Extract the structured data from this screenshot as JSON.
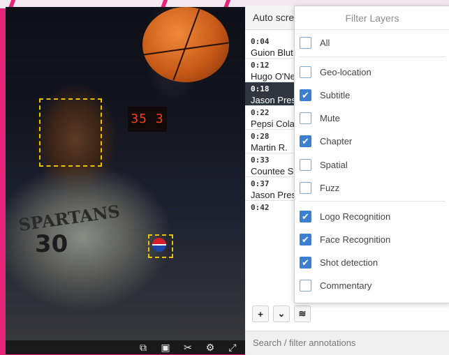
{
  "video": {
    "scoreboard_text": "35 3",
    "jersey_text": "SPARTANS",
    "jersey_number": "30",
    "toolbar": [
      "crop-icon",
      "frame-icon",
      "scissors-icon",
      "gear-icon",
      "fullscreen-icon"
    ]
  },
  "panel": {
    "header_title": "Auto scre",
    "annotations": [
      {
        "time": "0:04",
        "name": "Guion Blut"
      },
      {
        "time": "0:12",
        "name": "Hugo O'Ne"
      },
      {
        "time": "0:18",
        "name": "Jason Pres",
        "active": true
      },
      {
        "time": "0:22",
        "name": "Pepsi Cola"
      },
      {
        "time": "0:28",
        "name": "Martin R."
      },
      {
        "time": "0:33",
        "name": "Countee S"
      },
      {
        "time": "0:37",
        "name": "Jason Pres"
      },
      {
        "time": "0:42",
        "name": ""
      }
    ],
    "actions": {
      "add": "+",
      "expand": "⌄",
      "layers": "≋"
    },
    "search_placeholder": "Search / filter annotations"
  },
  "filter": {
    "title": "Filter Layers",
    "options": [
      {
        "label": "All",
        "checked": false
      },
      {
        "label": "Geo-location",
        "checked": false
      },
      {
        "label": "Subtitle",
        "checked": true
      },
      {
        "label": "Mute",
        "checked": false
      },
      {
        "label": "Chapter",
        "checked": true
      },
      {
        "label": "Spatial",
        "checked": false
      },
      {
        "label": "Fuzz",
        "checked": false
      },
      {
        "label": "Logo Recognition",
        "checked": true
      },
      {
        "label": "Face Recognition",
        "checked": true
      },
      {
        "label": "Shot detection",
        "checked": true
      },
      {
        "label": "Commentary",
        "checked": false
      }
    ]
  },
  "colors": {
    "accent": "#3a7fd0",
    "active_row": "#2f3640",
    "detection_box": "#e8c400",
    "background": "#e8247a"
  }
}
